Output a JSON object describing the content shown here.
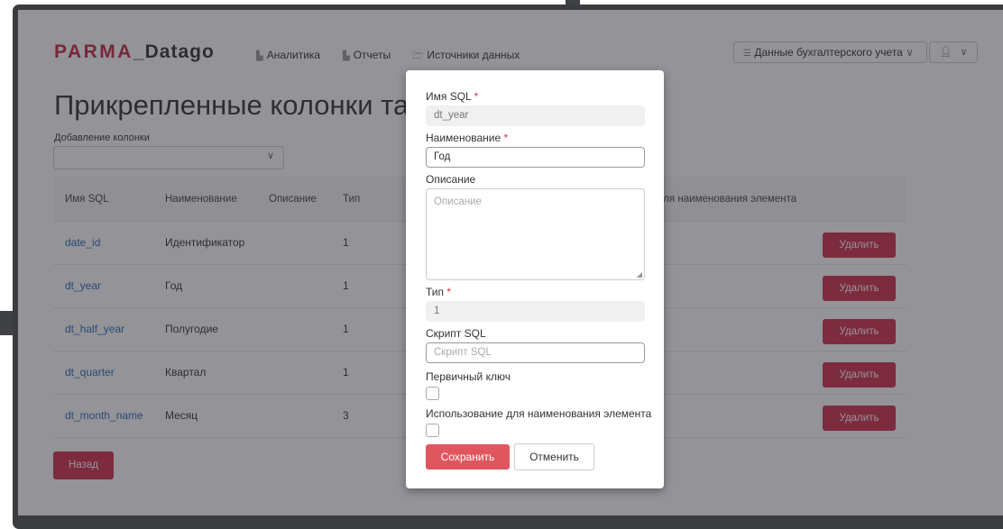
{
  "header": {
    "logo_brand": "PARMA",
    "logo_rest": "_Datago",
    "nav": [
      {
        "icon": "bar-chart-icon",
        "glyph": "▙",
        "label": "Аналитика"
      },
      {
        "icon": "report-icon",
        "glyph": "▙",
        "label": "Отчеты"
      },
      {
        "icon": "folder-icon",
        "glyph": "🗁",
        "label": "Источники данных"
      }
    ],
    "datasource_icon": "database-icon",
    "datasource_label": "Данные бухгалтерского учета",
    "datasource_chevron": "∨",
    "user_icon": "user-icon",
    "user_chevron": "∨"
  },
  "page": {
    "title": "Прикрепленные колонки таблицы",
    "add_column_label": "Добавление колонки",
    "add_column_value": ""
  },
  "table": {
    "headers": [
      "Имя SQL",
      "Наименование",
      "Описание",
      "Тип",
      "е для наименования элемента"
    ],
    "rows": [
      {
        "sql_name": "date_id",
        "name": "Идентификатор",
        "type": "1",
        "action": "Удалить"
      },
      {
        "sql_name": "dt_year",
        "name": "Год",
        "type": "1",
        "action": "Удалить"
      },
      {
        "sql_name": "dt_half_year",
        "name": "Полугодие",
        "type": "1",
        "action": "Удалить"
      },
      {
        "sql_name": "dt_quarter",
        "name": "Квартал",
        "type": "1",
        "action": "Удалить"
      },
      {
        "sql_name": "dt_month_name",
        "name": "Месяц",
        "type": "3",
        "action": "Удалить"
      }
    ]
  },
  "back_label": "Назад",
  "modal": {
    "sql_name_label": "Имя SQL",
    "sql_name_value": "dt_year",
    "name_label": "Наименование",
    "name_value": "Год",
    "description_label": "Описание",
    "description_placeholder": "Описание",
    "type_label": "Тип",
    "type_value": "1",
    "script_label": "Скрипт SQL",
    "script_placeholder": "Скрипт SQL",
    "primary_key_label": "Первичный ключ",
    "primary_key_checked": false,
    "use_for_name_label": "Использование для наименования элемента",
    "use_for_name_checked": false,
    "required_mark": "*",
    "save_label": "Сохранить",
    "cancel_label": "Отменить"
  },
  "colors": {
    "brand": "#c8283f",
    "danger": "#d32f4a",
    "link": "#2f6fb5",
    "save": "#e0565f"
  }
}
